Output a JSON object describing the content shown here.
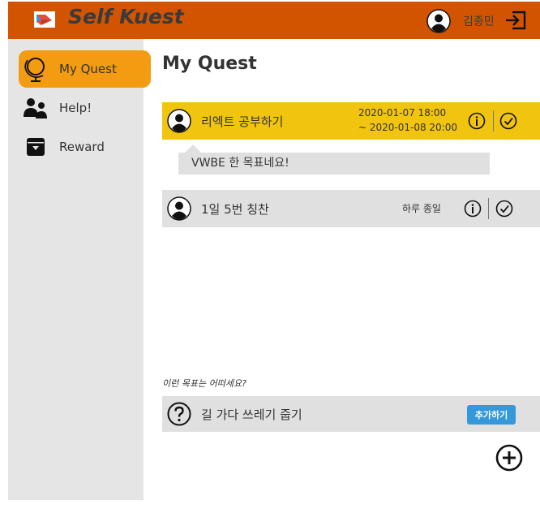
{
  "app": {
    "title": "Self Kuest",
    "user_name": "김종민"
  },
  "sidebar": {
    "items": [
      {
        "label": "My Quest",
        "icon": "globe-icon",
        "active": true
      },
      {
        "label": "Help!",
        "icon": "users-icon",
        "active": false
      },
      {
        "label": "Reward",
        "icon": "archive-icon",
        "active": false
      }
    ]
  },
  "main": {
    "title": "My Quest",
    "quests": [
      {
        "title": "리엑트 공부하기",
        "date_start": "2020-01-07 18:00",
        "date_end": "~ 2020-01-08 20:00",
        "comment": "VWBE 한 목표네요!"
      },
      {
        "title": "1일 5번 칭찬",
        "frequency": "하루 종일"
      }
    ],
    "suggestion_heading": "이런 목표는 어떠세요?",
    "suggestion": {
      "title": "길 가다 쓰레기 줍기",
      "add_label": "추가하기"
    }
  },
  "colors": {
    "header": "#d35400",
    "sidebar": "#e5e5e5",
    "active_nav": "#f39c12",
    "active_quest": "#f1c40f",
    "row": "#e0e0e0",
    "add_button": "#3498db"
  }
}
